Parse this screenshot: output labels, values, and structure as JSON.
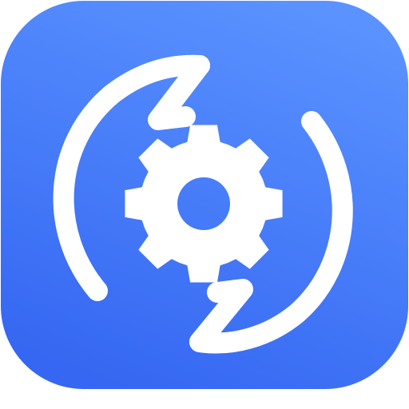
{
  "icon": {
    "name": "sync-gear-icon",
    "colors": {
      "background_top": "#5A92FF",
      "background_bottom": "#3567F2",
      "glyph": "#FFFFFF"
    }
  }
}
